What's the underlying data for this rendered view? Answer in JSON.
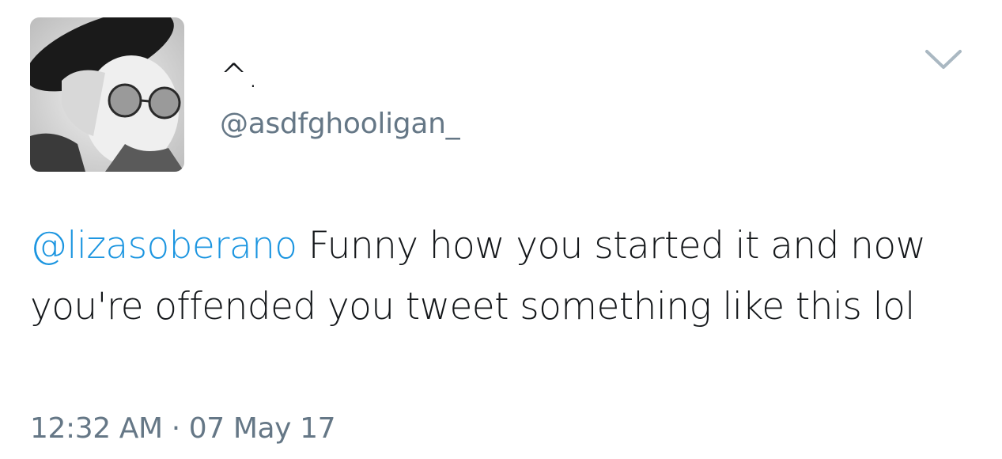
{
  "tweet": {
    "author": {
      "display_name": "^.",
      "handle": "@asdfghooligan_",
      "avatar": "profile-photo"
    },
    "menu_icon": "chevron-down-icon",
    "text": {
      "mention": "@lizasoberano",
      "body": " Funny how you started it and now you're offended you tweet something like this lol"
    },
    "timestamp": "12:32 AM · 07 May 17"
  },
  "colors": {
    "link": "#1b95e0",
    "secondary_text": "#657786",
    "primary_text": "#14171a",
    "chevron": "#aab8c2"
  }
}
